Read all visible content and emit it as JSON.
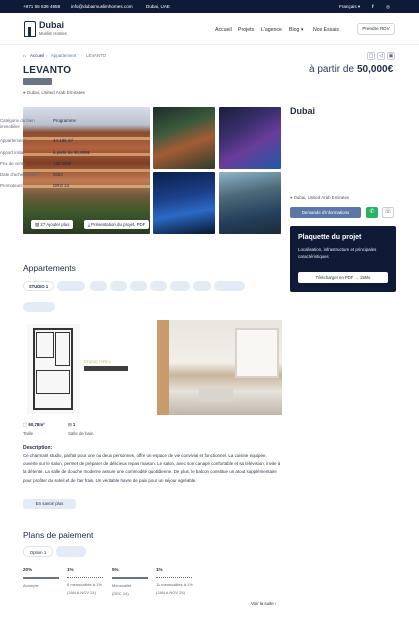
{
  "topbar": {
    "phone": "+971 55 636 4958",
    "email": "info@dubaimuslimhomes.com",
    "city": "Dubai, UAE",
    "language": "Français"
  },
  "header": {
    "logo_name": "Dubai",
    "logo_sub": "Muslim Homes",
    "nav": [
      "Accueil",
      "Projets",
      "L'agence",
      "Blog",
      "Nos Essais"
    ],
    "cta": "Prendre RDV"
  },
  "breadcrumb": [
    "Accueil",
    "Appartement",
    "LEVANTO"
  ],
  "listing": {
    "title": "LEVANTO",
    "price_prefix": "à partir de",
    "price_value": "50,000€",
    "location": "Dubai, United Arab Emirates",
    "photos_btn": "27 Ajouter plus",
    "pdf_btn": "Présentation du projet, PDF"
  },
  "side": {
    "city": "Dubai",
    "rows": [
      {
        "k": "Catégorie du bien immobilier",
        "v": "Programme"
      },
      {
        "k": "Appartements",
        "v": "44-185 m²"
      },
      {
        "k": "Apport initial",
        "v": "à partir de 50,000€"
      },
      {
        "k": "Prix de vente",
        "v": "130,000€"
      },
      {
        "k": "Date d'achèvement",
        "v": "2024"
      },
      {
        "k": "Promoteurs",
        "v": "ORO 24"
      }
    ],
    "location": "Dubai, United Arab Emirates",
    "info_btn": "Demande d'informations",
    "plaq_title": "Plaquette du projet",
    "plaq_desc": "Localisation, infrastructure et principales caractéristiques",
    "plaq_btn": "Télécharger en PDF → 15Mo"
  },
  "apartments": {
    "heading": "Appartements",
    "active_tab": "STUDIO 1",
    "floor_label": "STUDIO TYPE 1",
    "size_value": "60,78m²",
    "size_label": "Taille",
    "bath_value": "1",
    "bath_label": "Salle de bain",
    "desc_title": "Description:",
    "desc_text": "Ce charmant studio, parfait pour une ou deux personnes, offre un espace de vie convivial et fonctionnel. La cuisine équipée, ouverte sur le salon, permet de préparer de délicieux repas maison. Le salon, avec son canapé confortable et sa télévision, invite à la détente. La salle de douche moderne assure une commodité quotidienne. De plus, le balcon constitue un atout supplémentaire pour profiter du soleil et de l'air frais. Un véritable havre de paix pour un séjour agréable.",
    "more_btn": "En savoir plus"
  },
  "payments": {
    "heading": "Plans de paiement",
    "active_tab": "Option 1",
    "cols": [
      {
        "pct": "20%",
        "label": "Acompte",
        "sub": ""
      },
      {
        "pct": "1%",
        "label": "6 mensualités à 1%",
        "sub": "(JAN A NOV 24)"
      },
      {
        "pct": "5%",
        "label": "Mensualité",
        "sub": "(DEC 24)"
      },
      {
        "pct": "1%",
        "label": "11 mensualités à 1%",
        "sub": "(JAN A NOV 25)"
      }
    ],
    "more_link": "Voir la suite ›"
  },
  "colors": {
    "navy": "#0e1a36",
    "accent": "#5b77a9",
    "whatsapp": "#26b364"
  }
}
